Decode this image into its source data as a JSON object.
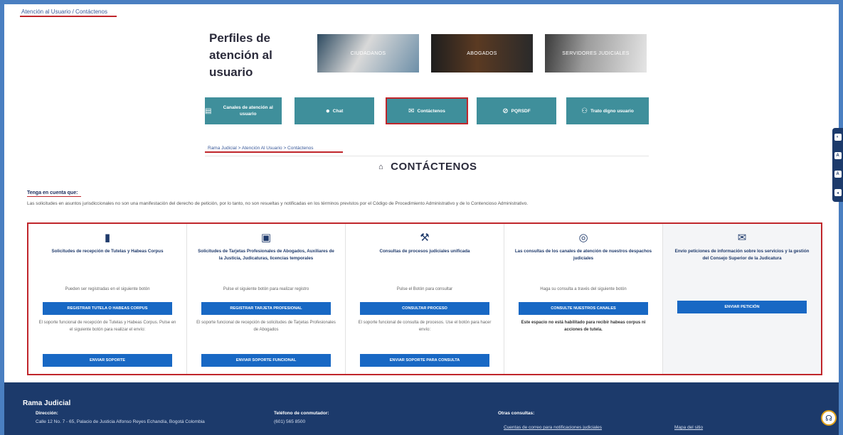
{
  "top_breadcrumb": "Atención al Usuario / Contáctenos",
  "profiles": {
    "title": "Perfiles de atención al usuario",
    "images": [
      {
        "label": "Ciudadanos"
      },
      {
        "label": "Abogados"
      },
      {
        "label": "Servidores Judiciales"
      }
    ]
  },
  "nav_buttons": [
    {
      "label": "Canales de atención al usuario",
      "icon": "book-icon"
    },
    {
      "label": "Chat",
      "icon": "chat-icon"
    },
    {
      "label": "Contáctenos",
      "icon": "envelope-open-icon"
    },
    {
      "label": "PQRSDF",
      "icon": "paperclip-icon"
    },
    {
      "label": "Trato digno usuario",
      "icon": "people-icon"
    }
  ],
  "breadcrumb": [
    "Rama Judicial",
    "Atención Al Usuario",
    "Contáctenos"
  ],
  "page_title": "CONTÁCTENOS",
  "notice": {
    "heading": "Tenga en cuenta que:",
    "body": "Las solicitudes en asuntos jurisdiccionales no son una manifestación del derecho de petición, por lo tanto, no son resueltas y notificadas en los términos previstos por el Código de Procedimiento Administrativo y de lo Contencioso Administrativo."
  },
  "cards": [
    {
      "title": "Solicitudes de recepción de Tutelas y Habeas Corpus",
      "desc": "Pueden ser registradas en el siguiente botón",
      "button1": "REGISTRAR TUTELA O HABEAS CORPUS",
      "note": "El soporte funcional de recepción de Tutelas y Habeas Corpus. Pulse en el siguiente botón para realizar el envío:",
      "button2": "ENVIAR SOPORTE"
    },
    {
      "title": "Solicitudes de Tarjetas Profesionales de Abogados, Auxiliares de la Justicia, Judicaturas, licencias temporales",
      "desc": "Pulse el siguiente botón para realizar registro",
      "button1": "REGISTRAR TARJETA PROFESIONAL",
      "note": "El soporte funcional de recepción de solicitudes de Tarjetas Profesionales de Abogados",
      "button2": "ENVIAR SOPORTE FUNCIONAL"
    },
    {
      "title": "Consultas de procesos judiciales unificada",
      "desc": "Pulse el Botón para consultar",
      "button1": "CONSULTAR PROCESO",
      "note": "El soporte funcional de consulta de procesos. Use el botón para hacer envío:",
      "button2": "ENVIAR SOPORTE PARA CONSULTA"
    },
    {
      "title": "Las consultas de los canales de atención de nuestros despachos judiciales",
      "desc": "Haga su consulta a través del siguiente botón",
      "button1": "CONSULTE NUESTROS CANALES",
      "note": "Este espacio no está habilitado para recibir habeas corpus ni acciones de tutela."
    },
    {
      "title": "Envío peticiones de información sobre los servicios y la gestión del Consejo Superior de la Judicatura",
      "button1": "ENVIAR PETICIÓN"
    }
  ],
  "footer": {
    "title": "Rama Judicial",
    "address_label": "Dirección:",
    "address": "Calle 12 No. 7 - 65, Palacio de Justicia Alfonso Reyes Echandía, Bogotá Colombia",
    "phone_label": "Teléfono de conmutador:",
    "phone": "(601) 565 8500",
    "other_label": "Otras consultas:",
    "link1": "Cuentas de correo para notificaciones judiciales",
    "link2": "Mapa del sitio"
  },
  "side_tools": [
    "◐",
    "A",
    "A",
    "◂"
  ]
}
